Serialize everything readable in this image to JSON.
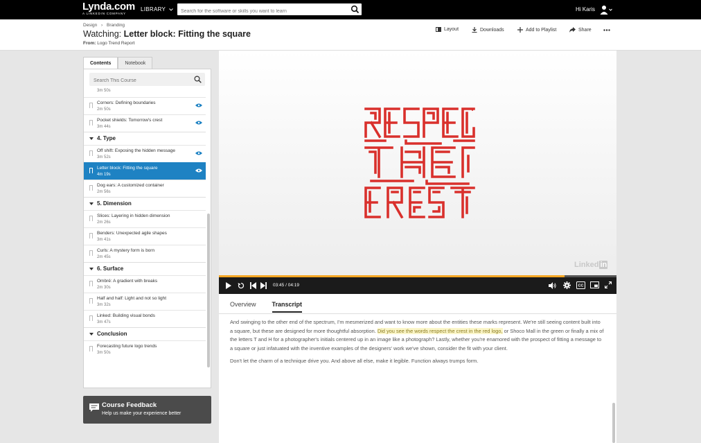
{
  "nav": {
    "brand": "Lynda.com",
    "brand_sub": "A LINKEDIN COMPANY",
    "library": "LIBRARY",
    "search_placeholder": "Search for the software or skills you want to learn",
    "greeting": "Hi Karis"
  },
  "header": {
    "breadcrumb": [
      "Design",
      "Branding"
    ],
    "watching_prefix": "Watching:",
    "title": "Letter block: Fitting the square",
    "from_label": "From:",
    "course": "Logo Trend Report",
    "actions": {
      "layout": "Layout",
      "downloads": "Downloads",
      "add_playlist": "Add to Playlist",
      "share": "Share"
    }
  },
  "sidebar": {
    "tabs": [
      "Contents",
      "Notebook"
    ],
    "search_placeholder": "Search This Course",
    "top_duration": "3m 50s",
    "groups": [
      {
        "title": "",
        "items": [
          {
            "title": "Corners: Defining boundaries",
            "duration": "2m 50s",
            "viewed": true
          },
          {
            "title": "Pocket shields: Tomorrow's crest",
            "duration": "3m 44s",
            "viewed": true
          }
        ]
      },
      {
        "title": "4. Type",
        "items": [
          {
            "title": "Off shift: Exposing the hidden message",
            "duration": "3m 52s",
            "viewed": true
          },
          {
            "title": "Letter block: Fitting the square",
            "duration": "4m 19s",
            "viewed": true,
            "active": true
          },
          {
            "title": "Dog ears: A customized container",
            "duration": "2m 56s",
            "viewed": false
          }
        ]
      },
      {
        "title": "5. Dimension",
        "items": [
          {
            "title": "Slices: Layering in hidden dimension",
            "duration": "2m 26s",
            "viewed": false
          },
          {
            "title": "Benders: Unexpected agile shapes",
            "duration": "3m 41s",
            "viewed": false
          },
          {
            "title": "Curls: A mystery form is born",
            "duration": "2m 45s",
            "viewed": false
          }
        ]
      },
      {
        "title": "6. Surface",
        "items": [
          {
            "title": "Ombré: A gradient with breaks",
            "duration": "2m 30s",
            "viewed": false
          },
          {
            "title": "Half and half: Light and not so light",
            "duration": "3m 32s",
            "viewed": false
          },
          {
            "title": "Linked: Building visual bonds",
            "duration": "3m 47s",
            "viewed": false
          }
        ]
      },
      {
        "title": "Conclusion",
        "items": [
          {
            "title": "Forecasting future logo trends",
            "duration": "3m 50s",
            "viewed": false
          }
        ]
      }
    ]
  },
  "feedback": {
    "title": "Course Feedback",
    "subtitle": "Help us make your experience better"
  },
  "player": {
    "current": "03:45",
    "total": "04:19",
    "progress": 0.869,
    "watermark": "Linked",
    "watermark_in": "in",
    "accent": "#f5a623",
    "logo_color": "#d9302c"
  },
  "panel": {
    "tabs": [
      "Overview",
      "Transcript"
    ],
    "active_tab": "Transcript",
    "p1_before": "And swinging to the other end of the spectrum, I'm mesmerized and want to know more about the entities these marks represent. We're still seeing content built into a square, but these are designed for more thoughtful absorption. ",
    "p1_highlight": "Did you see the words respect the crest in the red logo,",
    "p1_after": " or Shoco Mall in the green or finally a mix of the letters T and H for a photographer's initials centered up in an image like a photograph? Lastly, whether you're enamored with the prospect of fitting a message to a square or just infatuated with the inventive examples of the designers' work we've shown, consider the fit with your client.",
    "p2": "Don't let the charm of a technique drive you. And above all else, make it legible. Function always trumps form."
  }
}
